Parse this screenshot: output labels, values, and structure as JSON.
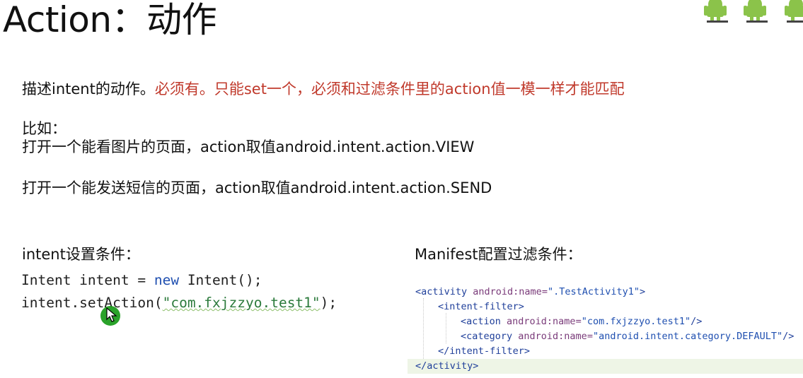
{
  "slide": {
    "title": "Action：动作",
    "desc_prefix": "描述intent的动作。",
    "desc_red": "必须有。只能set一个，必须和过滤条件里的action值一模一样才能匹配",
    "example_label": "比如：",
    "example_1": "打开一个能看图片的页面，action取值android.intent.action.VIEW",
    "example_2": "打开一个能发送短信的页面，action取值android.intent.action.SEND",
    "left_heading": "intent设置条件：",
    "right_heading": "Manifest配置过滤条件："
  },
  "java_code": {
    "line1_a": "Intent intent = ",
    "line1_kw": "new",
    "line1_b": " Intent();",
    "line2_a": "intent.setAction(",
    "line2_str": "\"com.fxjzzyo.test1\"",
    "line2_b": ");"
  },
  "xml_code": {
    "l1_open": "<activity ",
    "l1_attr": "android:name=",
    "l1_val": "\".TestActivity1\"",
    "l1_close": ">",
    "l2": "<intent-filter>",
    "l3_open": "<action ",
    "l3_attr": "android:name=",
    "l3_val": "\"com.fxjzzyo.test1\"",
    "l3_close": "/>",
    "l4_open": "<category ",
    "l4_attr": "android:name=",
    "l4_val": "\"android.intent.category.DEFAULT\"",
    "l4_close": "/>",
    "l5": "</intent-filter>",
    "l6": "</activity>"
  },
  "colors": {
    "accent_red": "#c0392b",
    "keyword_blue": "#1f4fb0",
    "android_green": "#8bc34a"
  },
  "icons": [
    "android-robot-icon",
    "cursor-icon"
  ]
}
